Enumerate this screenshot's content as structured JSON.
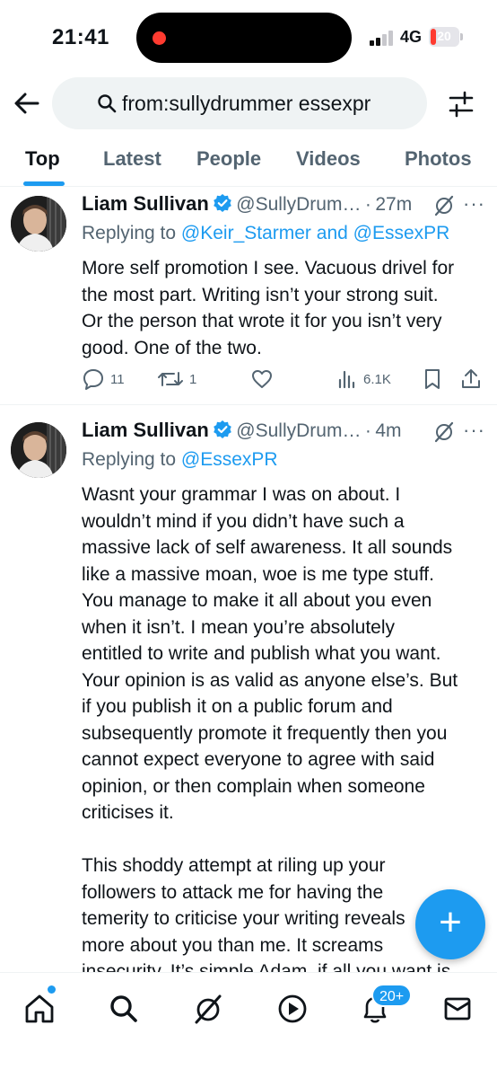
{
  "status_bar": {
    "time": "21:41",
    "network": "4G",
    "battery": "20",
    "battery_level": 0.2
  },
  "search": {
    "query": "from:sullydrummer essexpr"
  },
  "tabs": [
    {
      "label": "Top",
      "active": true
    },
    {
      "label": "Latest",
      "active": false
    },
    {
      "label": "People",
      "active": false
    },
    {
      "label": "Videos",
      "active": false
    },
    {
      "label": "Photos",
      "active": false
    }
  ],
  "tweets": [
    {
      "display_name": "Liam Sullivan",
      "handle": "@SullyDrum…",
      "dot": "·",
      "time": "27m",
      "more": "···",
      "reply_prefix": "Replying to",
      "reply_mentions": "@Keir_Starmer and @EssexPR",
      "lines": [
        "More self promotion I see. Vacuous drivel for",
        "the most part. Writing isn’t your strong suit.",
        "Or the person that wrote it for you isn’t very",
        "good. One of the two."
      ],
      "replies": "11",
      "reposts": "1",
      "views": "6.1K"
    },
    {
      "display_name": "Liam Sullivan",
      "handle": "@SullyDrum…",
      "dot": "·",
      "time": "4m",
      "more": "···",
      "reply_prefix": "Replying to",
      "reply_mentions": "@EssexPR",
      "lines": [
        "Wasnt your grammar I was on about. I",
        "wouldn’t mind if you didn’t have such a",
        "massive lack of self awareness. It all sounds",
        "like a massive moan, woe is me type stuff.",
        "You manage to make it all about you even",
        "when it isn’t. I mean you’re absolutely",
        "entitled to write and publish what you want.",
        "Your opinion is as valid as anyone else’s. But",
        "if you publish it on a public forum and",
        "subsequently promote it frequently then you",
        "cannot expect everyone to agree with said",
        "opinion, or then complain when someone",
        "criticises it.",
        "",
        "This shoddy attempt at riling up your",
        "followers to attack me for having the",
        "temerity to criticise your writing reveals",
        "more about you than me. It screams",
        "insecurity. It’s simple Adam, if all you want is"
      ]
    }
  ],
  "fab": {
    "label": "+"
  },
  "bottom_nav": {
    "notifications_badge": "20+"
  },
  "colors": {
    "accent": "#1d9bf0",
    "text": "#0f1419",
    "secondary": "#536471"
  }
}
